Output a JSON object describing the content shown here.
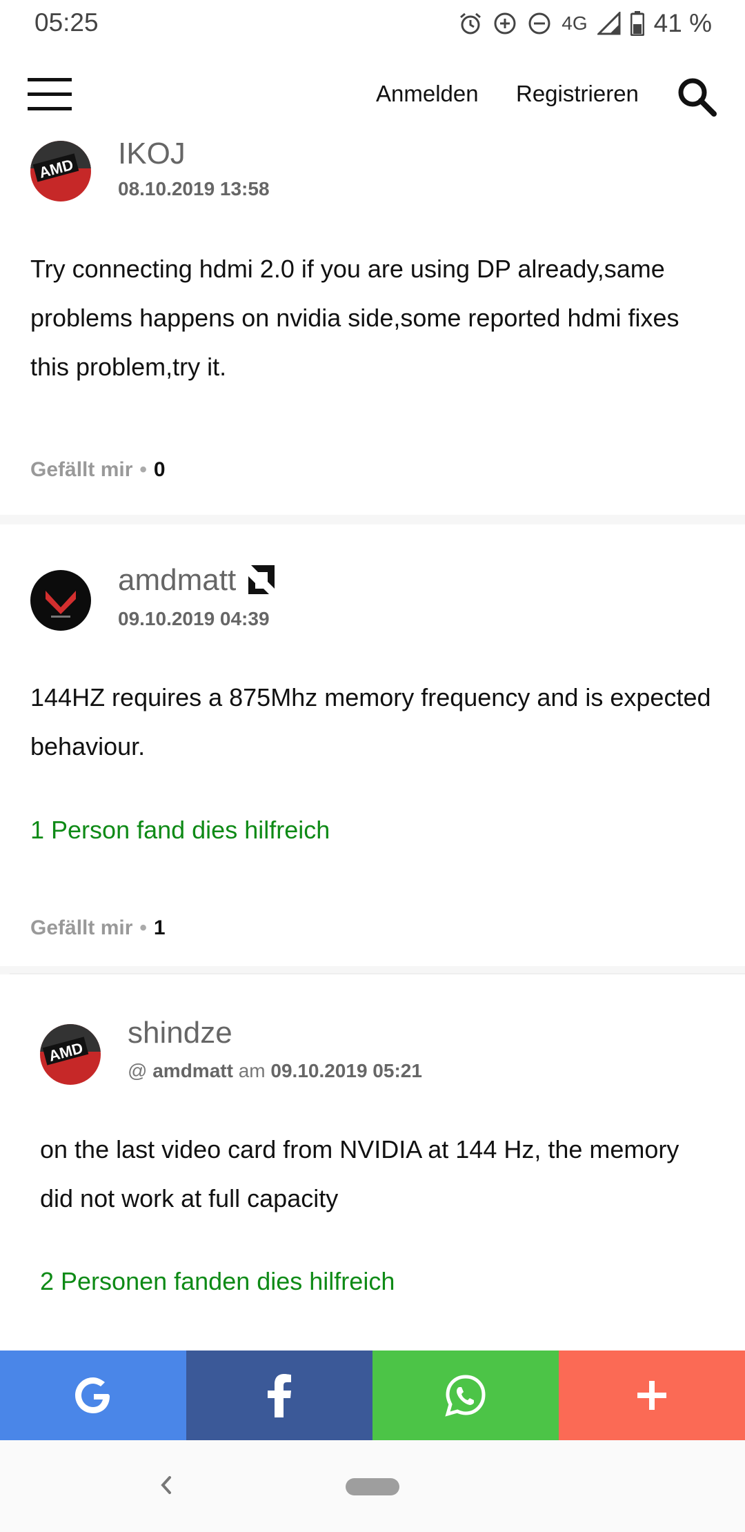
{
  "status_bar": {
    "time": "05:25",
    "network": "4G",
    "battery": "41 %",
    "icons": [
      "alarm-icon",
      "data-saver-icon",
      "do-not-disturb-icon",
      "signal-icon",
      "battery-icon"
    ]
  },
  "header": {
    "login_label": "Anmelden",
    "register_label": "Registrieren",
    "icons": [
      "menu-icon",
      "search-icon"
    ]
  },
  "posts": [
    {
      "author": "IKOJ",
      "date": "08.10.2019 13:58",
      "body": "Try connecting hdmi 2.0 if you are using DP already,same problems happens on nvidia side,some reported hdmi fixes this problem,try it.",
      "like_label": "Gefällt mir",
      "like_count": "0"
    },
    {
      "author": "amdmatt",
      "date": "09.10.2019 04:39",
      "body": "144HZ requires a 875Mhz memory frequency and is expected behaviour.",
      "helpful": "1 Person fand dies hilfreich",
      "like_label": "Gefällt mir",
      "like_count": "1"
    },
    {
      "author": "shindze",
      "reply_prefix": "@",
      "reply_to": "amdmatt",
      "reply_mid": "am",
      "date": "09.10.2019 05:21",
      "body": "on the last video card from NVIDIA at 144 Hz, the memory did not work at full capacity",
      "helpful": "2 Personen fanden dies hilfreich"
    }
  ],
  "share_bar": {
    "buttons": [
      "google-icon",
      "facebook-icon",
      "whatsapp-icon",
      "plus-icon"
    ],
    "colors": {
      "google": "#4a86e8",
      "facebook": "#3b5998",
      "whatsapp": "#4cc447",
      "more": "#fb6a55"
    }
  },
  "accent_colors": {
    "helpful_text": "#0e8a16"
  }
}
